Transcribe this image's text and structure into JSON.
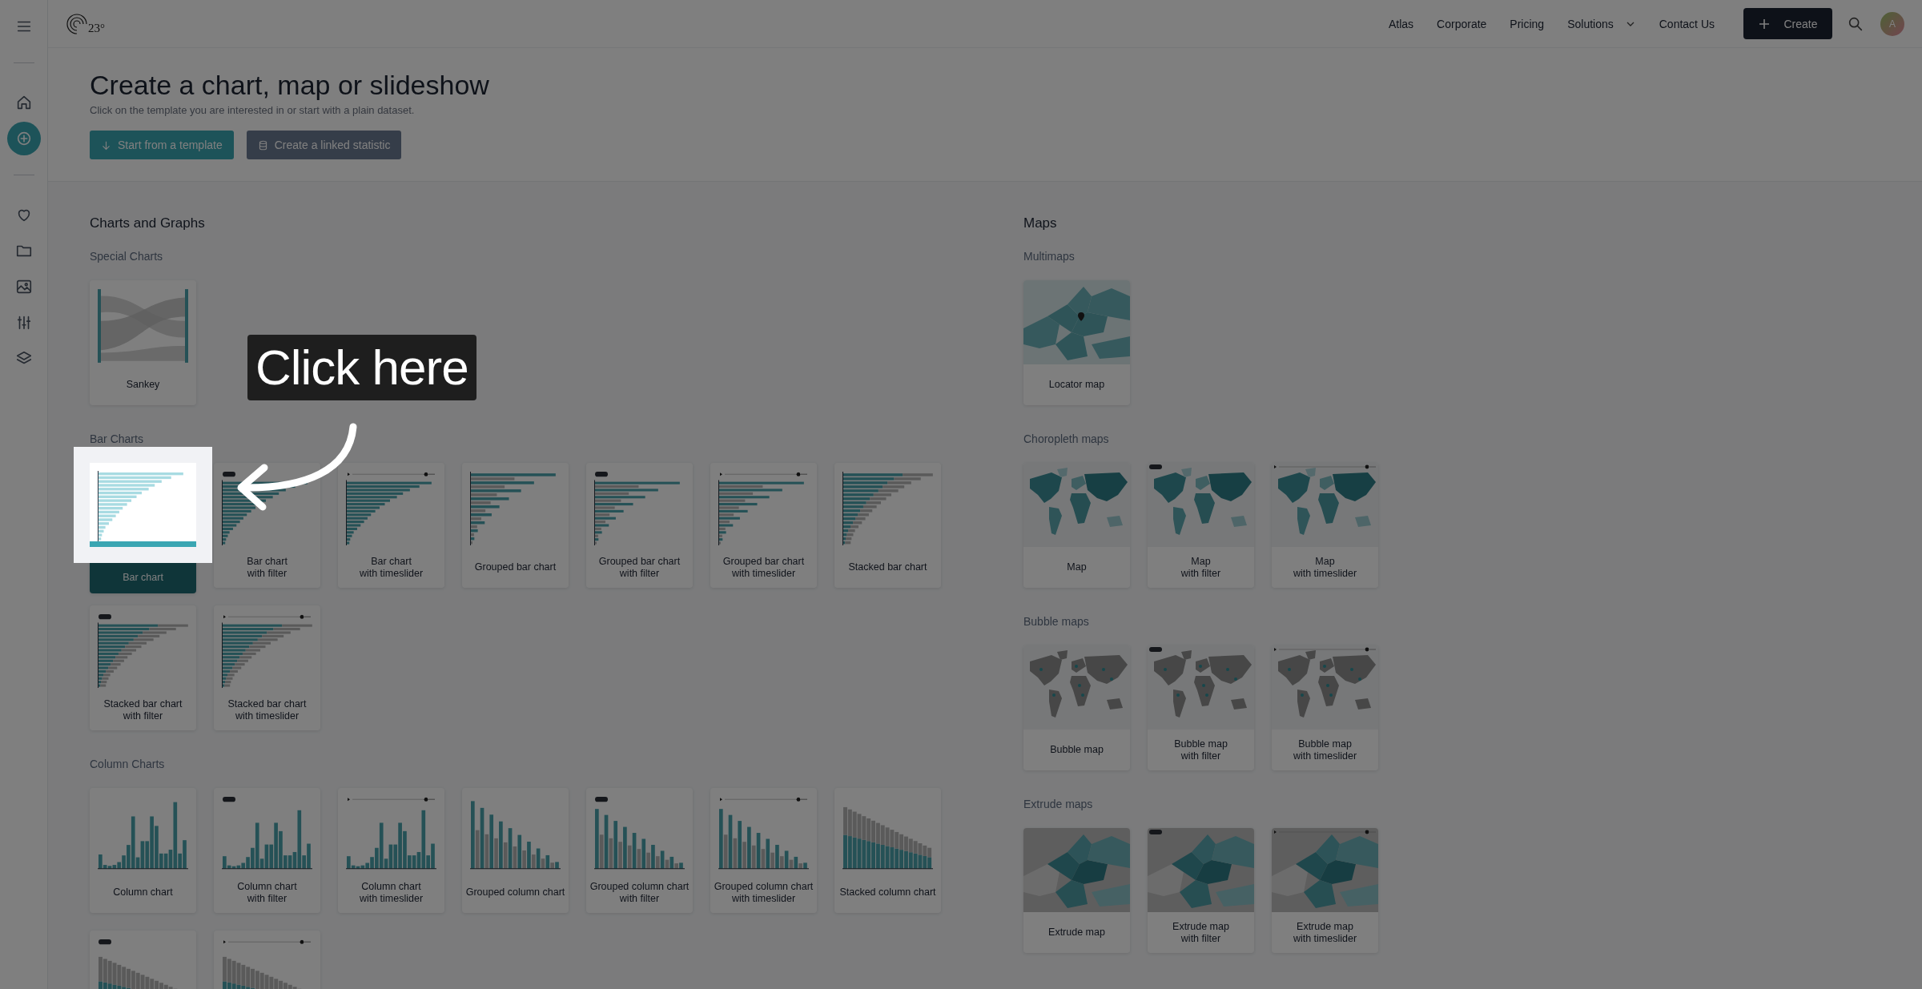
{
  "topbar": {
    "logo": "23°",
    "nav": [
      {
        "label": "Atlas",
        "dropdown": false
      },
      {
        "label": "Corporate",
        "dropdown": false
      },
      {
        "label": "Pricing",
        "dropdown": false
      },
      {
        "label": "Solutions",
        "dropdown": true
      },
      {
        "label": "Contact Us",
        "dropdown": false
      }
    ],
    "create_button": "Create",
    "avatar": "A"
  },
  "sidebar": {
    "groups": [
      [
        {
          "selected": false
        },
        {
          "selected": true
        }
      ],
      [
        {
          "selected": false
        },
        {
          "selected": false
        },
        {
          "selected": false
        },
        {
          "selected": false
        },
        {
          "selected": false
        }
      ]
    ]
  },
  "header": {
    "title": "Create a chart, map or slideshow",
    "subtitle": "Click on the template you are interested in or start with a plain dataset.",
    "buttons": [
      {
        "label": "Start from a template",
        "kind": "primary"
      },
      {
        "label": "Create a linked statistic",
        "kind": "secondary"
      }
    ]
  },
  "sections": [
    {
      "title": "Charts and Graphs",
      "groups": [
        {
          "title": "Special Charts",
          "cards": [
            {
              "label": "Sankey",
              "kind": "sankey",
              "selected": false
            }
          ]
        },
        {
          "title": "Bar Charts",
          "cards": [
            {
              "label": "Bar chart",
              "kind": "bar",
              "selected": true
            },
            {
              "label": "Bar chart\nwith filter",
              "kind": "bar-filter",
              "selected": false
            },
            {
              "label": "Bar chart\nwith timeslider",
              "kind": "bar-timeslider",
              "selected": false
            },
            {
              "label": "Grouped bar chart",
              "kind": "grouped-bar",
              "selected": false
            },
            {
              "label": "Grouped bar chart\nwith filter",
              "kind": "grouped-bar-filter",
              "selected": false
            },
            {
              "label": "Grouped bar chart\nwith timeslider",
              "kind": "grouped-bar-timeslider",
              "selected": false
            },
            {
              "label": "Stacked bar chart",
              "kind": "stacked-bar",
              "selected": false
            },
            {
              "label": "Stacked bar chart\nwith filter",
              "kind": "stacked-bar-filter",
              "selected": false
            },
            {
              "label": "Stacked bar chart\nwith timeslider",
              "kind": "stacked-bar-timeslider",
              "selected": false
            }
          ]
        },
        {
          "title": "Column Charts",
          "cards": [
            {
              "label": "Column chart",
              "kind": "column",
              "selected": false
            },
            {
              "label": "Column chart\nwith filter",
              "kind": "column-filter",
              "selected": false
            },
            {
              "label": "Column chart\nwith timeslider",
              "kind": "column-timeslider",
              "selected": false
            },
            {
              "label": "Grouped column chart",
              "kind": "grouped-column",
              "selected": false
            },
            {
              "label": "Grouped column chart\nwith filter",
              "kind": "grouped-column-filter",
              "selected": false
            },
            {
              "label": "Grouped column chart\nwith timeslider",
              "kind": "grouped-column-timeslider",
              "selected": false
            },
            {
              "label": "Stacked column chart",
              "kind": "stacked-column",
              "selected": false
            },
            {
              "kind": "stacked-column-filter",
              "selected": false
            },
            {
              "kind": "stacked-column-timeslider",
              "selected": false
            }
          ]
        }
      ]
    },
    {
      "title": "Maps",
      "groups": [
        {
          "title": "Multimaps",
          "cards": [
            {
              "label": "Locator map",
              "kind": "locator-map",
              "selected": false
            }
          ]
        },
        {
          "title": "Choropleth maps",
          "cards": [
            {
              "label": "Map",
              "kind": "choropleth-map",
              "selected": false
            },
            {
              "label": "Map\nwith filter",
              "kind": "choropleth-map-filter",
              "selected": false
            },
            {
              "label": "Map\nwith timeslider",
              "kind": "choropleth-map-timeslider",
              "selected": false
            }
          ]
        },
        {
          "title": "Bubble maps",
          "cards": [
            {
              "label": "Bubble map",
              "kind": "bubble-map",
              "selected": false
            },
            {
              "label": "Bubble map\nwith filter",
              "kind": "bubble-map-filter",
              "selected": false
            },
            {
              "label": "Bubble map\nwith timeslider",
              "kind": "bubble-map-timeslider",
              "selected": false
            }
          ]
        },
        {
          "title": "Extrude maps",
          "cards": [
            {
              "label": "Extrude map",
              "kind": "extrude-map",
              "selected": false
            },
            {
              "label": "Extrude map\nwith filter",
              "kind": "extrude-map-filter",
              "selected": false
            },
            {
              "label": "Extrude map\nwith timeslider",
              "kind": "extrude-map-timeslider",
              "selected": false
            }
          ]
        }
      ]
    }
  ],
  "guide": {
    "callout": "Click here"
  }
}
